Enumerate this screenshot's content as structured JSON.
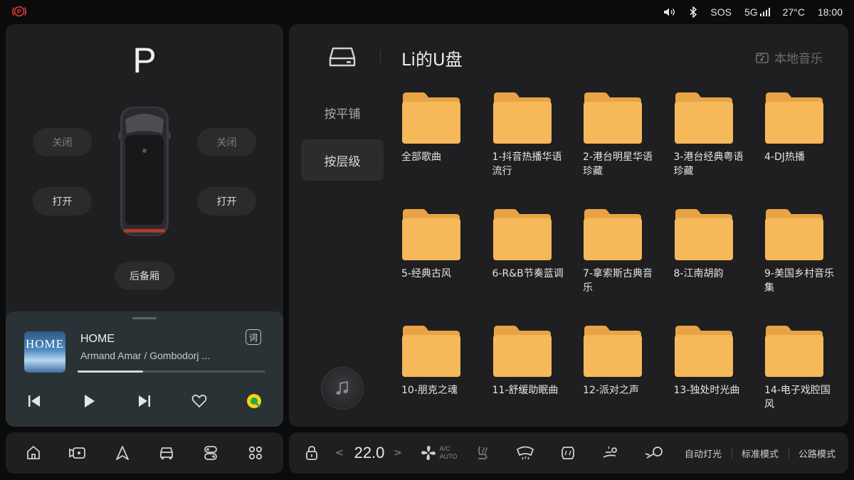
{
  "status_bar": {
    "sos": "SOS",
    "network": "5G",
    "temperature": "27°C",
    "time": "18:00",
    "icons": [
      "parking-brake-icon",
      "volume-icon",
      "bluetooth-icon",
      "signal-icon"
    ],
    "park_color": "#e23b3b"
  },
  "vehicle": {
    "gear": "P",
    "left_top_button": "关闭",
    "right_top_button": "关闭",
    "left_bottom_button": "打开",
    "right_bottom_button": "打开",
    "trunk_button": "后备厢"
  },
  "player": {
    "album_text": "HOME",
    "title": "HOME",
    "artist": "Armand Amar / Gombodorj ...",
    "lyrics_label": "词",
    "progress": 0.35
  },
  "left_dock": {
    "icons": [
      "home-icon",
      "camera-icon",
      "navigation-icon",
      "car-icon",
      "controls-icon",
      "apps-icon"
    ]
  },
  "music_browser": {
    "drive_title": "Li的U盘",
    "local_music": "本地音乐",
    "tabs": [
      {
        "label": "按平铺",
        "active": false
      },
      {
        "label": "按层级",
        "active": true
      }
    ],
    "folders": [
      "全部歌曲",
      "1-抖音热播华语流行",
      "2-港台明星华语珍藏",
      "3-港台经典粤语珍藏",
      "4-DJ热播",
      "5-经典古风",
      "6-R&B节奏蓝调",
      "7-拿索斯古典音乐",
      "8-江南胡韵",
      "9-美国乡村音乐集",
      "10-朋克之魂",
      "11-舒缓助眠曲",
      "12-派对之声",
      "13-独处时光曲",
      "14-电子戏腔国风"
    ],
    "folder_color": "#f5b95a",
    "folder_tab_color": "#e8a444"
  },
  "climate_dock": {
    "temperature": "22.0",
    "ac_line1": "A/C",
    "ac_line2": "AUTO",
    "modes": [
      "自动灯光",
      "标准模式",
      "公路模式"
    ]
  }
}
